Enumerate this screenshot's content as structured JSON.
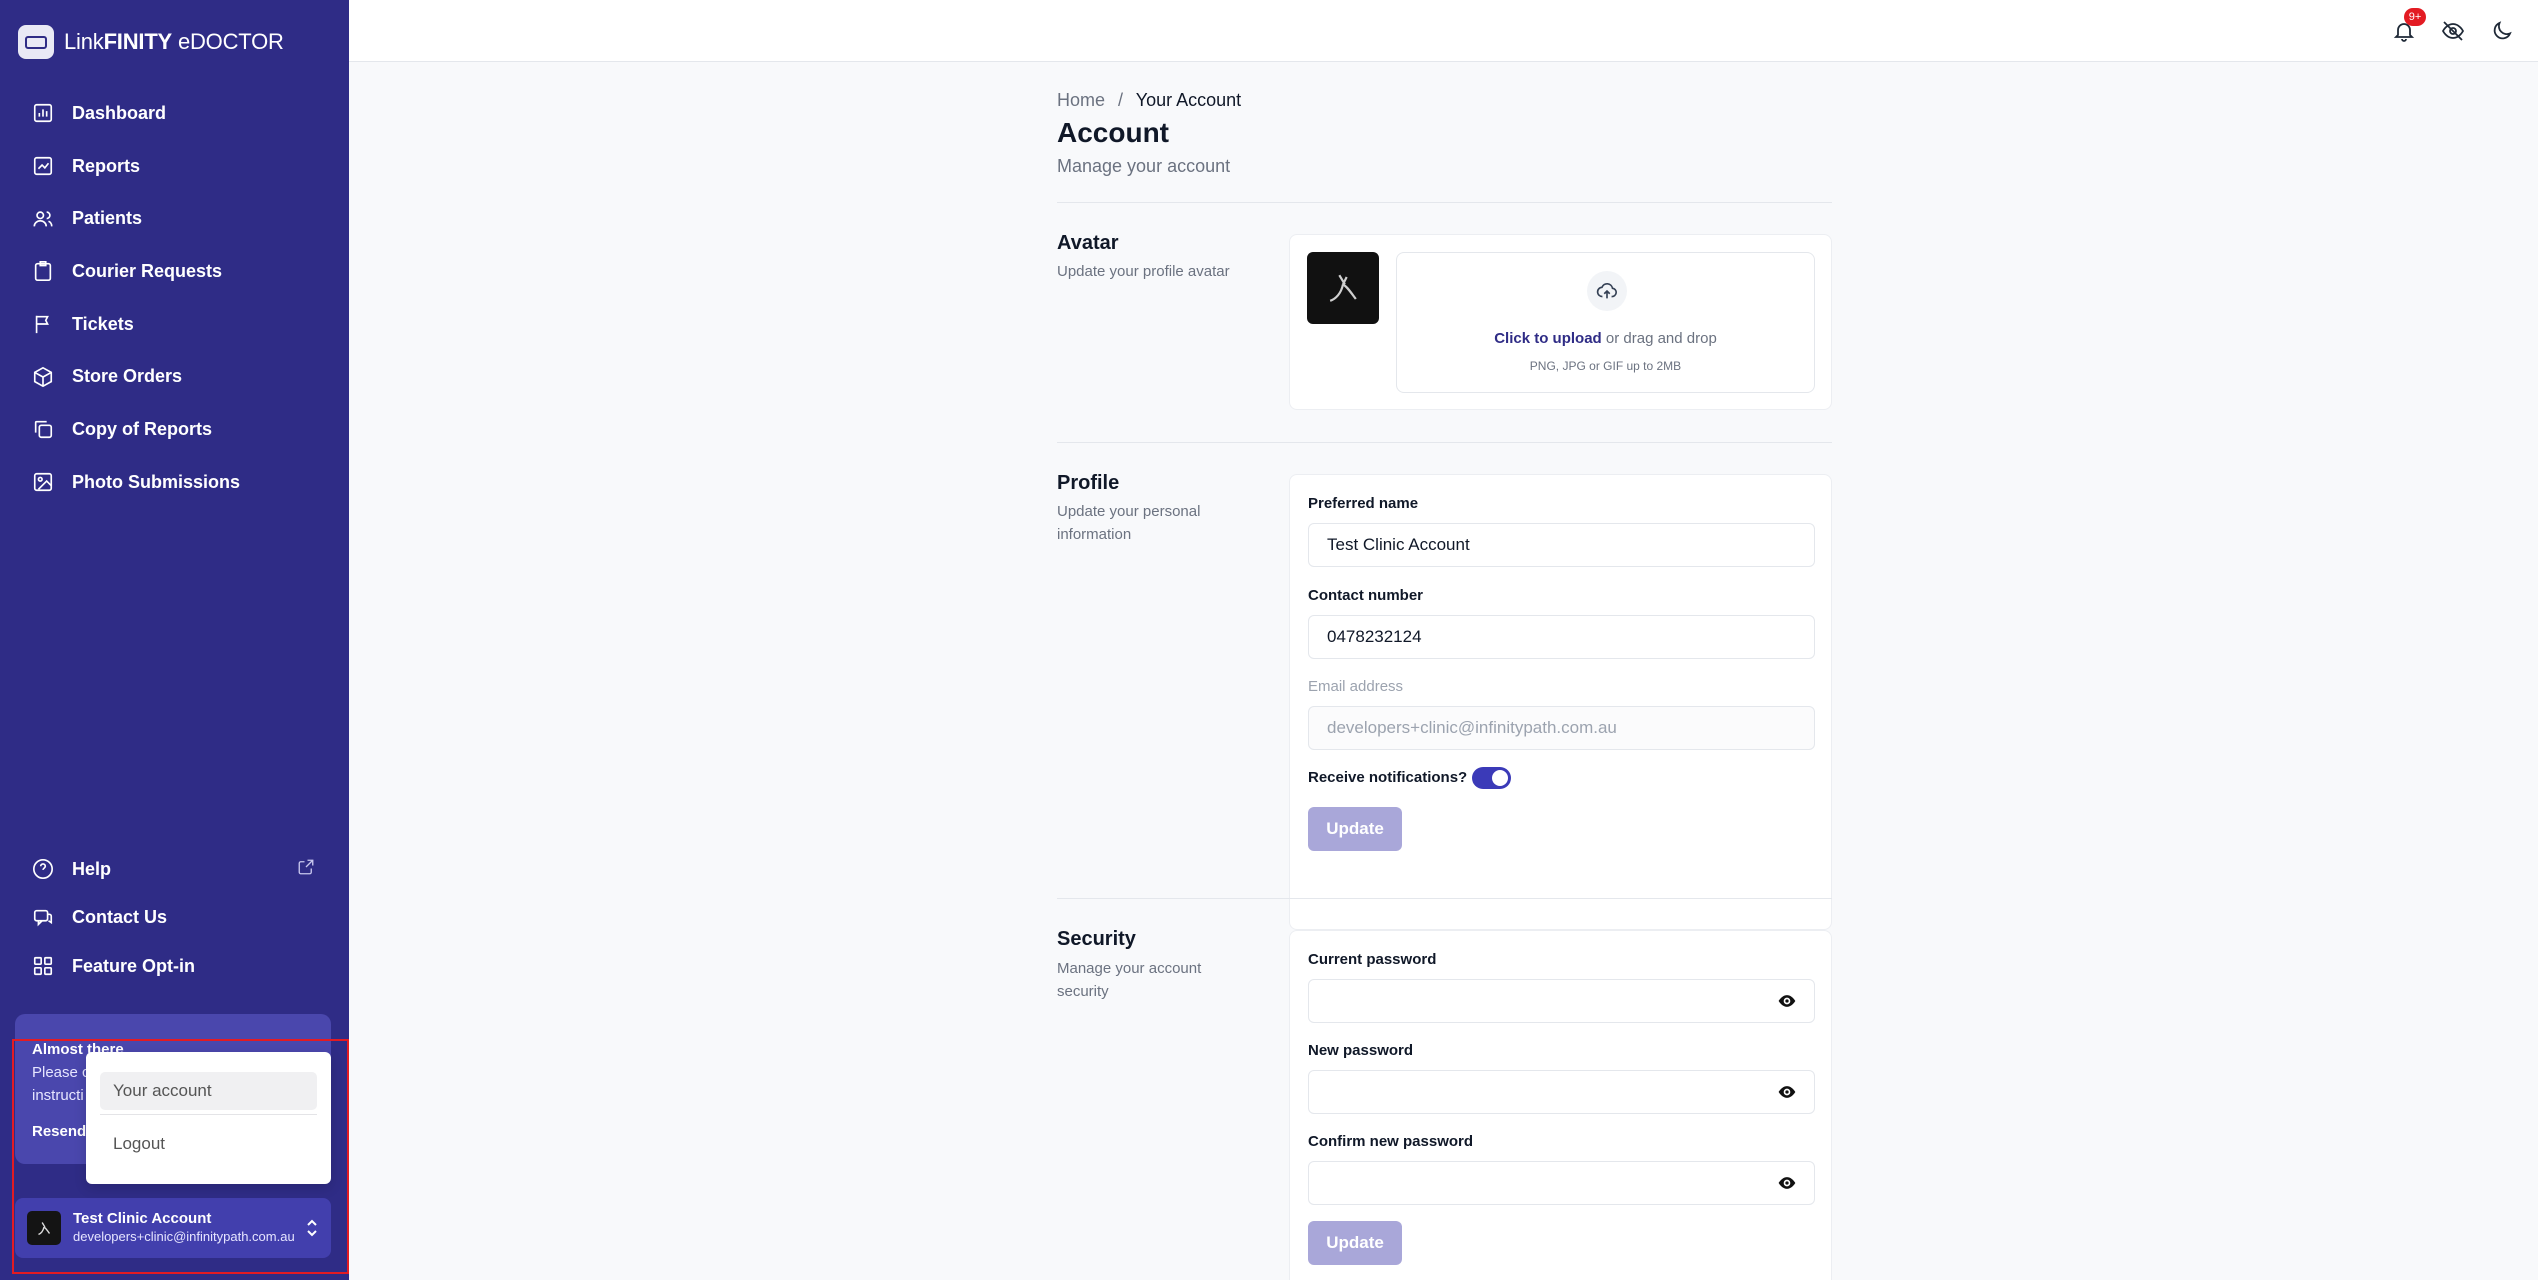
{
  "brand": {
    "prefix": "Link",
    "bold": "FINITY",
    "suffix": " eDOCTOR"
  },
  "sidebar": {
    "items": [
      {
        "label": "Dashboard",
        "icon": "chart-icon"
      },
      {
        "label": "Reports",
        "icon": "report-icon"
      },
      {
        "label": "Patients",
        "icon": "users-icon"
      },
      {
        "label": "Courier Requests",
        "icon": "clipboard-icon"
      },
      {
        "label": "Tickets",
        "icon": "flag-icon"
      },
      {
        "label": "Store Orders",
        "icon": "box-icon"
      },
      {
        "label": "Copy of Reports",
        "icon": "copy-icon"
      },
      {
        "label": "Photo Submissions",
        "icon": "image-icon"
      }
    ],
    "bottom": [
      {
        "label": "Help",
        "icon": "help-icon"
      },
      {
        "label": "Contact Us",
        "icon": "chat-icon"
      },
      {
        "label": "Feature Opt-in",
        "icon": "grid-icon"
      }
    ]
  },
  "almost": {
    "title": "Almost there",
    "body_1": "Please c",
    "body_2": "instructi",
    "resend": "Resend"
  },
  "account": {
    "name": "Test Clinic Account",
    "email": "developers+clinic@infinitypath.com.au"
  },
  "dropdown": {
    "item_1": "Your account",
    "item_2": "Logout"
  },
  "topbar": {
    "badge": "9+"
  },
  "breadcrumb": {
    "home": "Home",
    "sep": "/",
    "current": "Your Account"
  },
  "page": {
    "title": "Account",
    "subtitle": "Manage your account"
  },
  "avatar": {
    "title": "Avatar",
    "desc": "Update your profile avatar",
    "upload_link": "Click to upload",
    "upload_rest": " or drag and drop",
    "upload_hint": "PNG, JPG or GIF up to 2MB"
  },
  "profile": {
    "title": "Profile",
    "desc": "Update your personal information",
    "preferred_label": "Preferred name",
    "preferred_value": "Test Clinic Account",
    "contact_label": "Contact number",
    "contact_value": "0478232124",
    "email_label": "Email address",
    "email_value": "developers+clinic@infinitypath.com.au",
    "notif_label": "Receive notifications?",
    "notif_on": true,
    "update": "Update"
  },
  "security": {
    "title": "Security",
    "desc": "Manage your account security",
    "current_label": "Current password",
    "new_label": "New password",
    "confirm_label": "Confirm new password",
    "update": "Update"
  }
}
